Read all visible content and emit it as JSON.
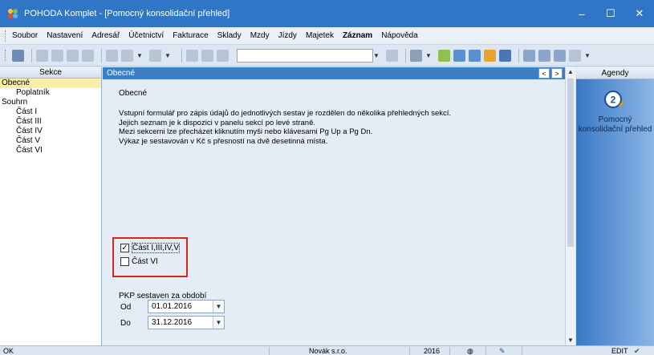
{
  "window": {
    "title": "POHODA Komplet - [Pomocný konsolidační přehled]",
    "controls": {
      "minimize": "–",
      "maximize": "☐",
      "close": "✕"
    }
  },
  "menu": {
    "items": [
      "Soubor",
      "Nastavení",
      "Adresář",
      "Účetnictví",
      "Fakturace",
      "Sklady",
      "Mzdy",
      "Jízdy",
      "Majetek",
      "Záznam",
      "Nápověda"
    ]
  },
  "toolbar": {
    "search_value": "",
    "icons": [
      "sort-icon",
      "copy-icon",
      "search-icon",
      "filter-icon",
      "undo-icon",
      "check-icon",
      "back-icon",
      "save-icon",
      "print-icon",
      "paste-icon",
      "filter-funnel-icon",
      "folder-icon",
      "tag-icon",
      "table-icon",
      "calc-icon",
      "users-icon",
      "barcode-icon",
      "grid-icon",
      "list-icon",
      "help-icon"
    ]
  },
  "left_panel": {
    "title": "Sekce",
    "items": [
      {
        "label": "Obecné",
        "level": 0,
        "selected": true
      },
      {
        "label": "Poplatník",
        "level": 1,
        "selected": false
      },
      {
        "label": "Souhrn",
        "level": 0,
        "selected": false
      },
      {
        "label": "Část I",
        "level": 1,
        "selected": false
      },
      {
        "label": "Část III",
        "level": 1,
        "selected": false
      },
      {
        "label": "Část IV",
        "level": 1,
        "selected": false
      },
      {
        "label": "Část V",
        "level": 1,
        "selected": false
      },
      {
        "label": "Část VI",
        "level": 1,
        "selected": false
      }
    ]
  },
  "main": {
    "header": "Obecné",
    "prev_label": "<",
    "next_label": ">",
    "section_title": "Obecné",
    "description": [
      "Vstupní formulář pro zápis údajů do jednotlivých sestav je rozdělen do několika přehledných sekcí.",
      "Jejich seznam je k dispozici v panelu sekcí po levé straně.",
      "Mezi sekcemi lze přecházet kliknutím myši nebo klávesami Pg Up a Pg Dn.",
      "Výkaz je sestavován v Kč s přesností na dvě desetinná místa."
    ],
    "checkboxes": [
      {
        "label": "Část I,III,IV,V",
        "checked": true
      },
      {
        "label": "Část VI",
        "checked": false
      }
    ],
    "pkp_label": "PKP sestaven za období",
    "from_label": "Od",
    "from_value": "01.01.2016",
    "to_label": "Do",
    "to_value": "31.12.2016"
  },
  "right_panel": {
    "title": "Agendy",
    "agenda_label": "Pomocný konsolidační přehled"
  },
  "status": {
    "left": "OK",
    "company": "Novák s.r.o.",
    "year": "2016",
    "mode": "EDIT"
  },
  "colors": {
    "title_bar": "#2f76c6",
    "accent_header": "#3c7dc4",
    "selection": "#fbeea8",
    "highlight_border": "#d9261c"
  }
}
